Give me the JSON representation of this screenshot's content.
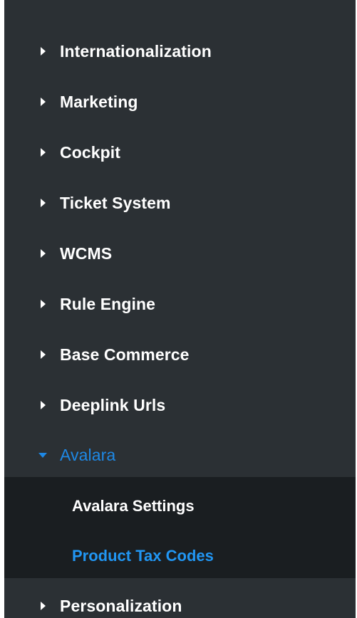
{
  "nav": {
    "items": [
      {
        "label": "Internationalization",
        "expanded": false
      },
      {
        "label": "Marketing",
        "expanded": false
      },
      {
        "label": "Cockpit",
        "expanded": false
      },
      {
        "label": "Ticket System",
        "expanded": false
      },
      {
        "label": "WCMS",
        "expanded": false
      },
      {
        "label": "Rule Engine",
        "expanded": false
      },
      {
        "label": "Base Commerce",
        "expanded": false
      },
      {
        "label": "Deeplink Urls",
        "expanded": false
      },
      {
        "label": "Avalara",
        "expanded": true
      },
      {
        "label": "Personalization",
        "expanded": false
      }
    ],
    "avalara_children": [
      {
        "label": "Avalara Settings",
        "selected": false
      },
      {
        "label": "Product Tax Codes",
        "selected": true
      }
    ]
  },
  "colors": {
    "panel_bg": "#2b3034",
    "subpanel_bg": "#1a1e21",
    "text": "#ffffff",
    "accent": "#1e88e5",
    "selected_link": "#2196f3"
  },
  "icons": {
    "collapsed": "caret-right-icon",
    "expanded": "caret-down-icon"
  }
}
